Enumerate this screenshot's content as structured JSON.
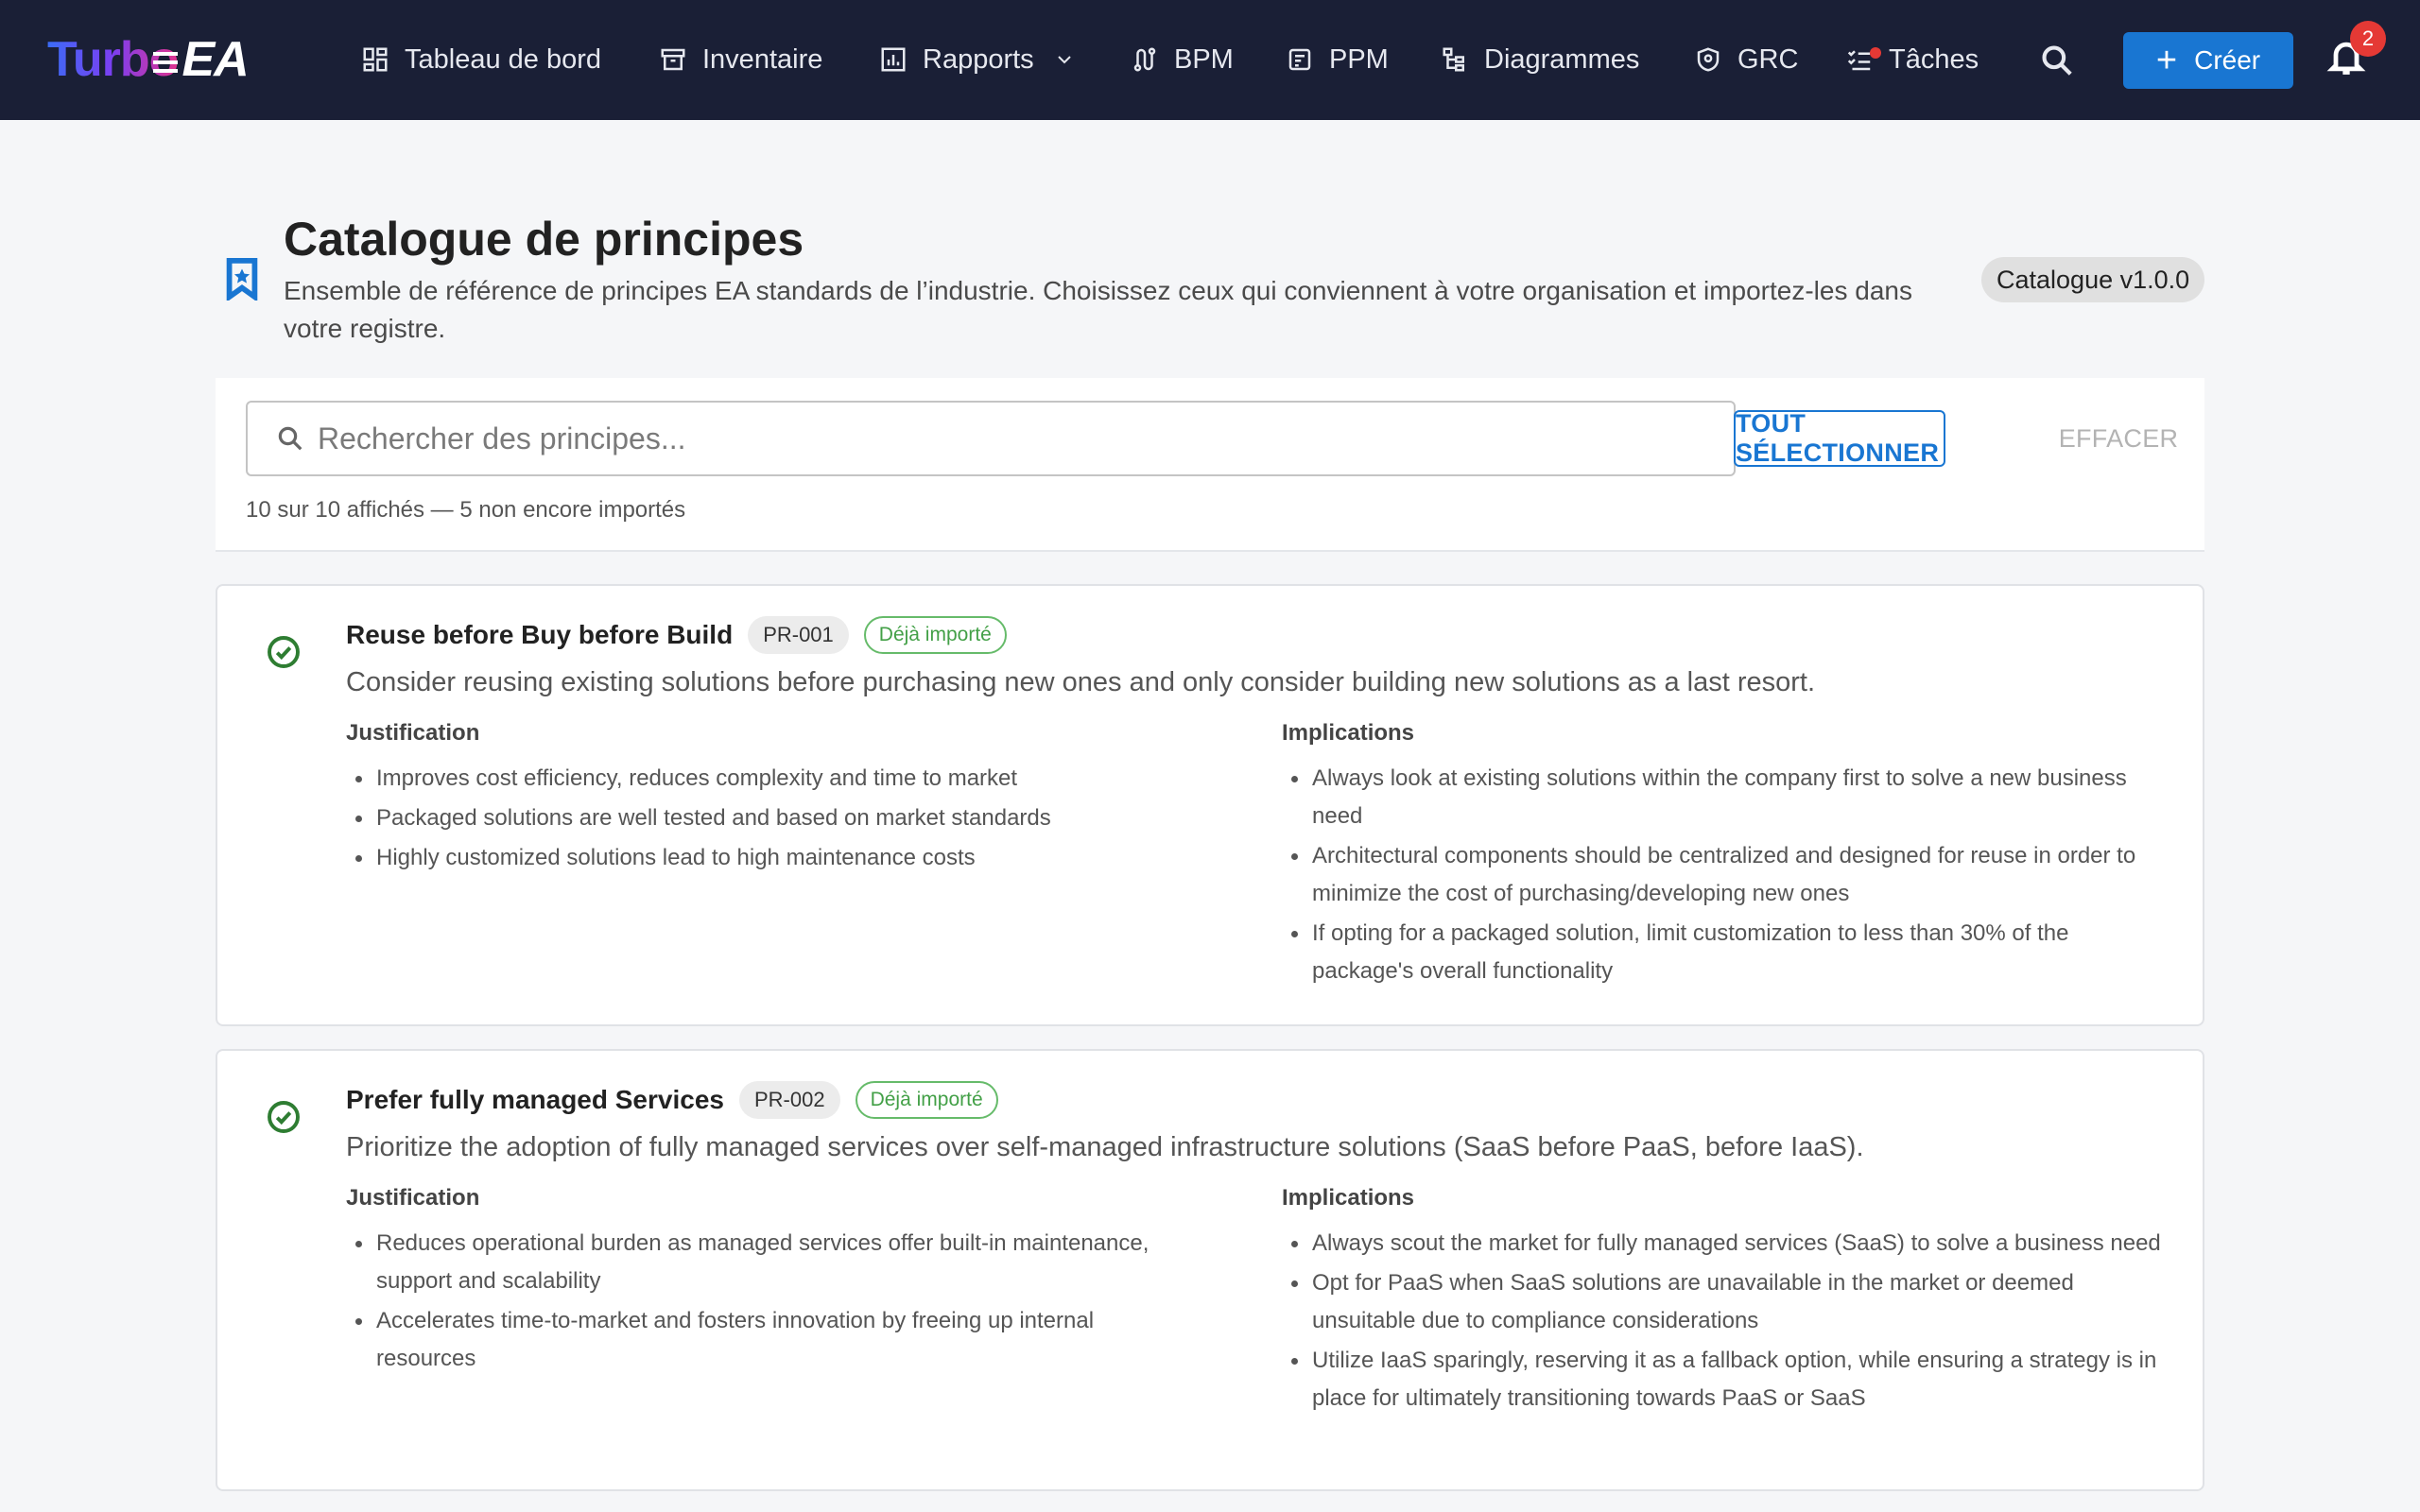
{
  "nav": {
    "logo_part1": "Turbo",
    "logo_part2": "EA",
    "items": [
      {
        "label": "Tableau de bord",
        "icon": "dashboard-icon"
      },
      {
        "label": "Inventaire",
        "icon": "archive-icon"
      },
      {
        "label": "Rapports",
        "icon": "bar-chart-icon"
      },
      {
        "label": "BPM",
        "icon": "route-icon"
      },
      {
        "label": "PPM",
        "icon": "project-icon"
      },
      {
        "label": "Diagrammes",
        "icon": "hierarchy-icon"
      },
      {
        "label": "GRC",
        "icon": "shield-icon"
      },
      {
        "label": "Tâches",
        "icon": "checklist-icon"
      }
    ],
    "create_label": "Créer",
    "notification_count": "2"
  },
  "header": {
    "title": "Catalogue de principes",
    "subtitle": "Ensemble de référence de principes EA standards de l’industrie. Choisissez ceux qui conviennent à votre organisation et importez-les dans votre registre.",
    "version": "Catalogue v1.0.0"
  },
  "toolbar": {
    "search_placeholder": "Rechercher des principes...",
    "select_all_label": "TOUT SÉLECTIONNER",
    "clear_label": "EFFACER",
    "counter_text": "10 sur 10 affichés — 5 non encore importés"
  },
  "labels": {
    "justification": "Justification",
    "implications": "Implications",
    "imported": "Déjà importé"
  },
  "principles": [
    {
      "title": "Reuse before Buy before Build",
      "code": "PR-001",
      "description": "Consider reusing existing solutions before purchasing new ones and only consider building new solutions as a last resort.",
      "justification": [
        "Improves cost efficiency, reduces complexity and time to market",
        "Packaged solutions are well tested and based on market standards",
        "Highly customized solutions lead to high maintenance costs"
      ],
      "implications": [
        "Always look at existing solutions within the company first to solve a new business need",
        "Architectural components should be centralized and designed for reuse in order to minimize the cost of purchasing/developing new ones",
        "If opting for a packaged solution, limit customization to less than 30% of the package's overall functionality"
      ]
    },
    {
      "title": "Prefer fully managed Services",
      "code": "PR-002",
      "description": "Prioritize the adoption of fully managed services over self-managed infrastructure solutions (SaaS before PaaS, before IaaS).",
      "justification": [
        "Reduces operational burden as managed services offer built-in maintenance, support and scalability",
        "Accelerates time-to-market and fosters innovation by freeing up internal resources"
      ],
      "implications": [
        "Always scout the market for fully managed services (SaaS) to solve a business need",
        "Opt for PaaS when SaaS solutions are unavailable in the market or deemed unsuitable due to compliance considerations",
        "Utilize IaaS sparingly, reserving it as a fallback option, while ensuring a strategy is in place for ultimately transitioning towards PaaS or SaaS"
      ]
    }
  ],
  "colors": {
    "topbar": "#1a1f36",
    "primary": "#1976d2",
    "success": "#43a047",
    "badge": "#e53935"
  }
}
